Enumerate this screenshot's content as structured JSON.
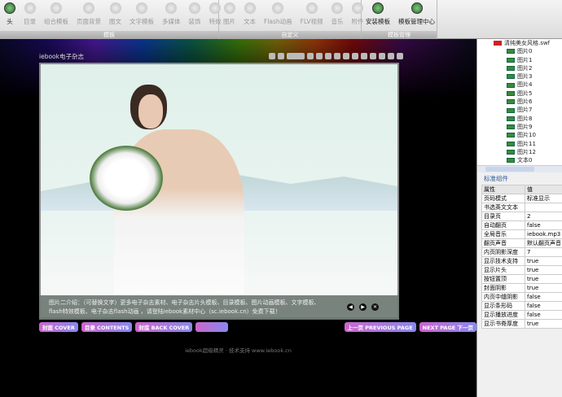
{
  "toolbar": {
    "groups": [
      {
        "label": "模板",
        "items": [
          "头",
          "目录",
          "组合模板",
          "页面背景",
          "图文",
          "文字模板",
          "多媒体",
          "装饰",
          "特效"
        ]
      },
      {
        "label": "自定义",
        "items": [
          "图片",
          "文本",
          "Flash动画",
          "FLV视频",
          "音乐",
          "附件"
        ]
      },
      {
        "label": "模板管理",
        "items": [
          "安装模板",
          "模板管理中心"
        ]
      }
    ]
  },
  "book": {
    "title": "iebook电子杂志",
    "caption": [
      "图片二介绍：（可替换文字）更多电子杂志素材、电子杂志片头模板、目录模板、图片动画模板、文字模板、",
      "flash特效模板、电子杂志flash动画 ，请登陆iebook素材中心（sc.iebook.cn）免费下载！"
    ],
    "nav": [
      "◀",
      "▶",
      "✕"
    ],
    "buttons": {
      "cover": "封面 COVER",
      "contents": "目录 CONTENTS",
      "back": "封底 BACK COVER",
      "prev": "上一页 PREVIOUS PAGE",
      "next": "NEXT PAGE 下一页"
    },
    "footer": "iebook超级精灵 · 技术支持 www.iebook.cn"
  },
  "tree": {
    "root": "清纯美女风格.swf",
    "items": [
      "图片0",
      "图片1",
      "图片2",
      "图片3",
      "图片4",
      "图片5",
      "图片6",
      "图片7",
      "图片8",
      "图片9",
      "图片10",
      "图片11",
      "图片12",
      "文本0"
    ]
  },
  "props": {
    "title": "标准组件",
    "header": [
      "属性",
      "值"
    ],
    "rows": [
      [
        "页码模式",
        "标准显示"
      ],
      [
        "书选英文文本",
        ""
      ],
      [
        "目录页",
        "2"
      ],
      [
        "自动翻页",
        "false"
      ],
      [
        "全局音乐",
        "iebook.mp3"
      ],
      [
        "翻页声音",
        "默认翻页声音"
      ],
      [
        "内页阴影深度",
        "7"
      ],
      [
        "显示技术支持",
        "true"
      ],
      [
        "显示片头",
        "true"
      ],
      [
        "按钮置顶",
        "true"
      ],
      [
        "封面阴影",
        "true"
      ],
      [
        "内页中缝阴影",
        "false"
      ],
      [
        "显示条形码",
        "false"
      ],
      [
        "显示播放进度",
        "false"
      ],
      [
        "显示书脊厚度",
        "true"
      ]
    ]
  }
}
